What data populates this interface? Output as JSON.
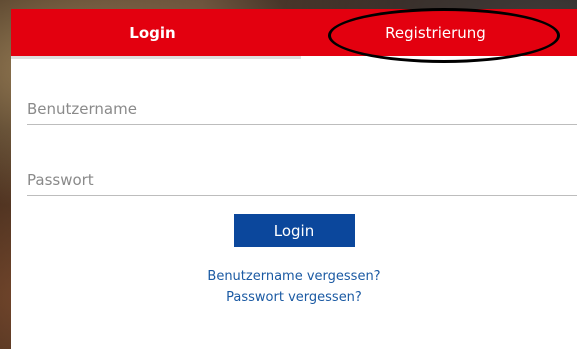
{
  "tabs": {
    "login_label": "Login",
    "register_label": "Registrierung"
  },
  "form": {
    "username_placeholder": "Benutzername",
    "password_placeholder": "Passwort",
    "login_button_label": "Login",
    "forgot_username_label": "Benutzername vergessen?",
    "forgot_password_label": "Passwort vergessen?"
  },
  "colors": {
    "accent_red": "#e3000f",
    "button_blue": "#0b479c",
    "link_blue": "#1b5aa3"
  }
}
